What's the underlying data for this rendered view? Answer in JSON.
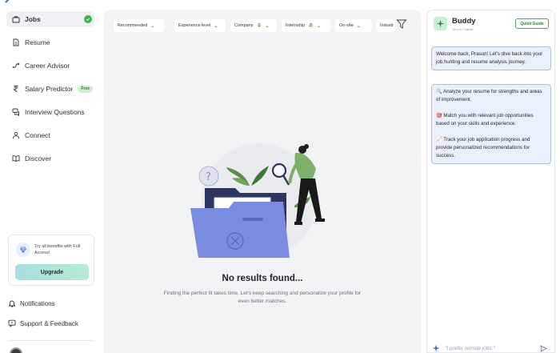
{
  "sidebar": {
    "items": [
      {
        "label": "Jobs",
        "icon": "briefcase-icon",
        "active": true
      },
      {
        "label": "Resume",
        "icon": "document-icon"
      },
      {
        "label": "Career Advisor",
        "icon": "route-icon"
      },
      {
        "label": "Salary Predictor",
        "icon": "rupee-icon",
        "badge": "Free"
      },
      {
        "label": "Interview Questions",
        "icon": "chat-bubbles-icon"
      },
      {
        "label": "Connect",
        "icon": "people-icon"
      },
      {
        "label": "Discover",
        "icon": "book-icon"
      }
    ],
    "promo": {
      "text": "Try all benefits with Full Access!",
      "button": "Upgrade"
    },
    "notifications": "Notifications",
    "support": "Support & Feedback"
  },
  "filters": {
    "recommended": "Recommended",
    "experience": "Experience level",
    "company": "Company",
    "company_count": "1",
    "internship": "Internship",
    "internship_count": "2",
    "onsite": "On-site",
    "industry": "Industr"
  },
  "empty_state": {
    "title": "No results found...",
    "subtitle": "Finding the perfect fit takes time. Let's keep searching and personalize your profile for even better matches."
  },
  "buddy": {
    "name": "Buddy",
    "subtitle": "Your AI Copilot",
    "quick_guide": "Quick Guide",
    "welcome": "Welcome back, Prasun! Let's dive back into your job hunting and resume analysis journey.",
    "capabilities": [
      "🔍 Analyze your resume for strengths and areas of improvement.",
      "🎯 Match you with relevant job opportunities based on your skills and experience.",
      "📈 Track your job application progress and provide personalized recommendations for success."
    ],
    "input_placeholder": "\"I prefer remote jobs.\""
  },
  "colors": {
    "accent_green": "#3bb54a",
    "folder_blue": "#7b8ce0",
    "message_bg": "#eaf0fb"
  }
}
